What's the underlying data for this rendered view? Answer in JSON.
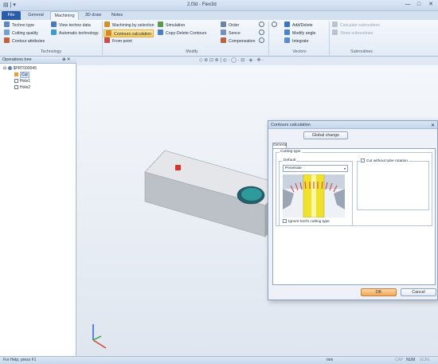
{
  "window": {
    "title": "2.f3d - Flex3d",
    "quick_access": "▤ | ▾",
    "minimize": "—",
    "maximize": "□",
    "close": "✕"
  },
  "tabs": [
    "File",
    "General",
    "Machining",
    "3D draw",
    "Notes"
  ],
  "ribbon": {
    "technology": {
      "label": "Technology",
      "items": [
        "Techno type",
        "Cutting quality",
        "Contour attributes",
        "View techno data",
        "Automatic technology"
      ]
    },
    "modify": {
      "label": "Modify",
      "items": [
        "Machining by selection",
        "Contours calculation",
        "From point",
        "Simulation",
        "Copy-Delete Contours",
        "Order",
        "Sence",
        "Compensation"
      ]
    },
    "vectors": {
      "label": "Vectors",
      "items": [
        "Add/Delete",
        "Modify angle",
        "Integrate"
      ]
    },
    "subroutines": {
      "label": "Subroutines",
      "items": [
        "Calculate subroutines",
        "Show subroutines"
      ]
    }
  },
  "operations_tree": {
    "title": "Operations tree",
    "pin": "⊕ ✕",
    "items": [
      "$PRT000045",
      "Cut",
      "Hole1",
      "Hole2"
    ]
  },
  "quick_tools": "◇ ⊕ ⊡ ⊗ | ◎ · ◯ · ⊟ · ◈ · ✥ ·",
  "dialog": {
    "title": "Contours calculation",
    "close": "✕",
    "global_change": "Global change",
    "tab_general": "General",
    "cutting_type_label": "Cutting type",
    "default_label": "Default",
    "cut_without_tube_rotation": "Cut without tube rotation",
    "select_value": "Penetrate",
    "ignore_tool_cutting_type": "Ignore tool's cutting type",
    "ok": "OK",
    "cancel": "Cancel"
  },
  "status": {
    "help": "For Help, press F1",
    "units": "mm",
    "cap": "CAP",
    "num": "NUM",
    "scrl": "SCRL"
  },
  "colors": {
    "accent": "#2b5ca8",
    "selected": "#f7c95b",
    "hole_teal": "#2e9a9c"
  }
}
